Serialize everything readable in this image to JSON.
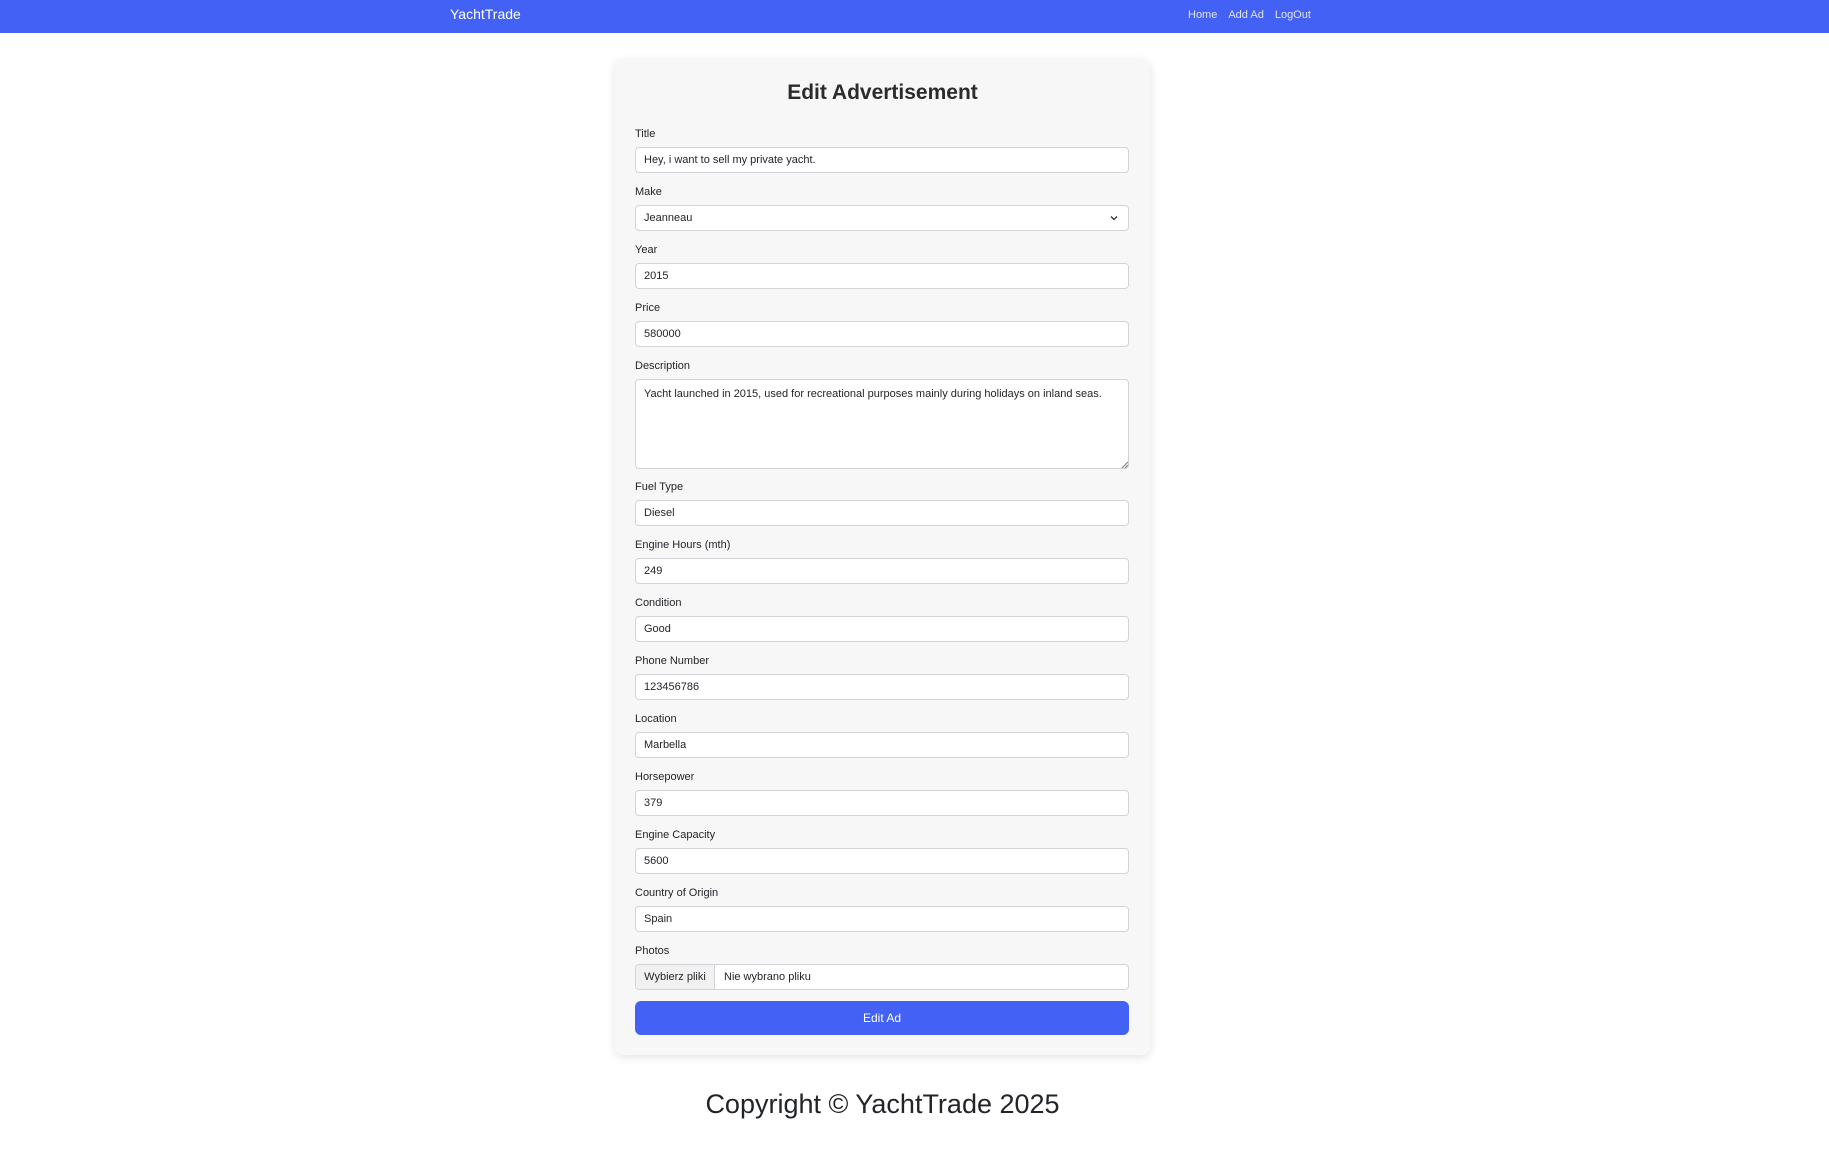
{
  "navbar": {
    "brand": "YachtTrade",
    "links": [
      "Home",
      "Add Ad",
      "LogOut"
    ],
    "color": "#4361f5"
  },
  "form": {
    "title": "Edit Advertisement",
    "fields": {
      "title": {
        "label": "Title",
        "value": "Hey, i want to sell my private yacht."
      },
      "make": {
        "label": "Make",
        "value": "Jeanneau"
      },
      "year": {
        "label": "Year",
        "value": "2015"
      },
      "price": {
        "label": "Price",
        "value": "580000"
      },
      "description": {
        "label": "Description",
        "value": "Yacht launched in 2015, used for recreational purposes mainly during holidays on inland seas."
      },
      "fuel_type": {
        "label": "Fuel Type",
        "value": "Diesel"
      },
      "engine_hours": {
        "label": "Engine Hours (mth)",
        "value": "249"
      },
      "condition": {
        "label": "Condition",
        "value": "Good"
      },
      "phone": {
        "label": "Phone Number",
        "value": "123456786"
      },
      "location": {
        "label": "Location",
        "value": "Marbella"
      },
      "horsepower": {
        "label": "Horsepower",
        "value": "379"
      },
      "engine_capacity": {
        "label": "Engine Capacity",
        "value": "5600"
      },
      "country": {
        "label": "Country of Origin",
        "value": "Spain"
      },
      "photos": {
        "label": "Photos",
        "button": "Wybierz pliki",
        "status": "Nie wybrano pliku"
      }
    },
    "submit_label": "Edit Ad"
  },
  "footer": {
    "text": "Copyright © YachtTrade 2025"
  }
}
